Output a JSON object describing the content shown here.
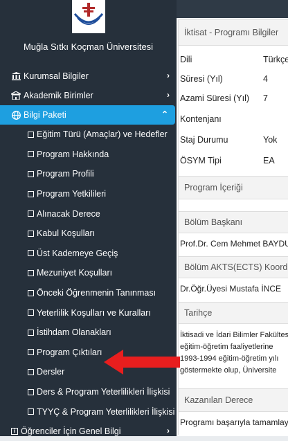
{
  "university": {
    "name": "Muğla Sıtkı Koçman Üniversitesi"
  },
  "sidebar": {
    "items": [
      {
        "label": "Kurumsal Bilgiler",
        "icon": "bank-icon"
      },
      {
        "label": "Akademik Birimler",
        "icon": "building-icon"
      },
      {
        "label": "Bilgi Paketi",
        "icon": "globe-icon"
      }
    ],
    "subitems": [
      "Eğitim Türü (Amaçlar) ve Hedefler",
      "Program Hakkında",
      "Program Profili",
      "Program Yetkilileri",
      "Alınacak Derece",
      "Kabul Koşulları",
      "Üst Kademeye Geçiş",
      "Mezuniyet Koşulları",
      "Önceki Öğrenmenin Tanınması",
      "Yeterlilik Koşulları ve Kuralları",
      "İstihdam Olanakları",
      "Program Çıktıları",
      "Dersler",
      "Ders & Program Yeterlilikleri İlişkisi",
      "TYYÇ & Program Yeterlilikleri İlişkisi"
    ],
    "bottom": {
      "label": "Öğrenciler İçin Genel Bilgi",
      "icon": "info-icon"
    }
  },
  "content": {
    "title": "İktisat - Programı Bilgiler",
    "info_rows": [
      {
        "key": "Dili",
        "value": "Türkçe"
      },
      {
        "key": "Süresi (Yıl)",
        "value": "4"
      },
      {
        "key": "Azami Süresi (Yıl)",
        "value": "7"
      },
      {
        "key": "Kontenjanı",
        "value": ""
      },
      {
        "key": "Staj Durumu",
        "value": "Yok"
      },
      {
        "key": "ÖSYM Tipi",
        "value": "EA"
      }
    ],
    "program_icerigi": "Program İçeriği",
    "bolum_baskani_head": "Bölüm Başkanı",
    "bolum_baskani": "Prof.Dr. Cem Mehmet BAYDUR",
    "akts_head": "Bölüm AKTS(ECTS) Koordinatörü",
    "akts": "Dr.Öğr.Üyesi Mustafa İNCE",
    "tarihce_head": "Tarihçe",
    "tarihce_lines": [
      "İktisadi ve İdari Bilimler Fakültesi",
      "eğitim-öğretim faaliyetlerine",
      "1993-1994 eğitim-öğretim yılı",
      "göstermekte olup, Üniversite"
    ],
    "kazanilan_head": "Kazanılan Derece",
    "kazanilan": "Programı başarıyla tamamlayan"
  },
  "colors": {
    "sidebar": "#26303b",
    "active": "#1e9fe0",
    "arrow": "#e81e1e"
  }
}
